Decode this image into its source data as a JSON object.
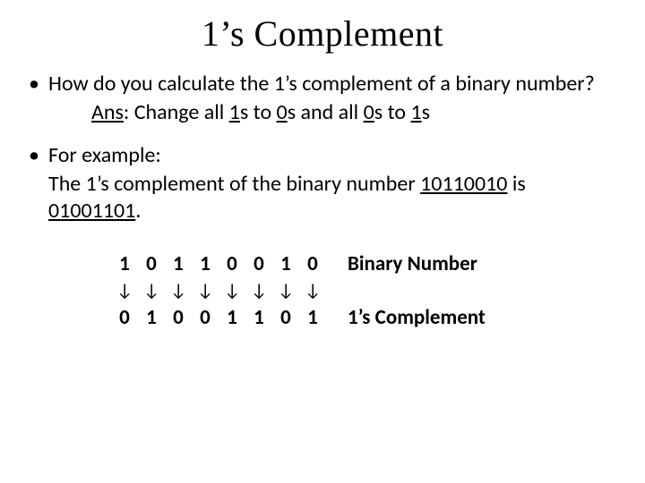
{
  "title": "1’s Complement",
  "bullet1": {
    "question": "How do you calculate the 1’s complement of a binary number?",
    "ans_label": "Ans",
    "ans_pre": ": Change all ",
    "ans_a": "1",
    "ans_mid1": "s to ",
    "ans_b": "0",
    "ans_mid2": "s and all ",
    "ans_c": "0",
    "ans_mid3": "s to ",
    "ans_d": "1",
    "ans_post": "s"
  },
  "bullet2": {
    "lead": "For example:",
    "line_pre": "The 1’s complement of the binary number ",
    "num_in": "10110010",
    "line_mid": " is ",
    "num_out": "01001101",
    "line_post": "."
  },
  "table": {
    "row1": [
      "1",
      "0",
      "1",
      "1",
      "0",
      "0",
      "1",
      "0"
    ],
    "arrow": "↓",
    "row2": [
      "0",
      "1",
      "0",
      "0",
      "1",
      "1",
      "0",
      "1"
    ],
    "label1": "Binary Number",
    "label2": "1’s Complement"
  }
}
